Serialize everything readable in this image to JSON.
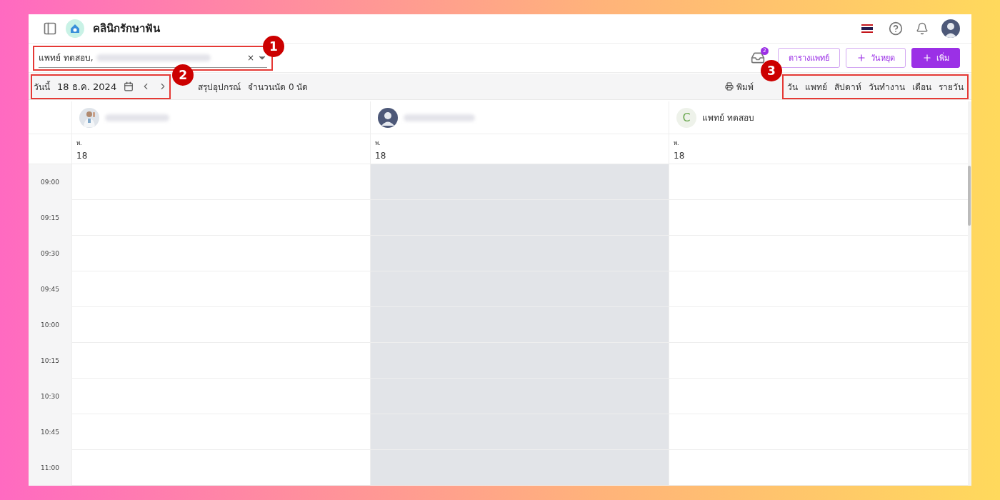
{
  "header": {
    "clinic_name": "คลินิกรักษาฟัน"
  },
  "doctor_filter": {
    "value": "แพทย์ ทดสอบ,",
    "clear": "×"
  },
  "inbox": {
    "count": "2"
  },
  "buttons": [
    {
      "label": "ตารางแพทย์",
      "kind": "outline"
    },
    {
      "label": "วันหยุด",
      "kind": "outline-plus"
    },
    {
      "label": "เพิ่ม",
      "kind": "primary-plus"
    }
  ],
  "date_bar": {
    "today": "วันนี้",
    "date": "18 ธ.ค. 2024",
    "summary": "สรุปอุปกรณ์",
    "count": "จำนวนนัด 0 นัด",
    "print": "พิมพ์"
  },
  "views": [
    "วัน",
    "แพทย์",
    "สัปดาห์",
    "วันทำงาน",
    "เดือน",
    "รายวัน"
  ],
  "columns": [
    {
      "weekday": "พ.",
      "day": "18",
      "unavailable": false
    },
    {
      "kind": "silhouette",
      "weekday": "พ.",
      "day": "18",
      "unavailable": true
    },
    {
      "kind": "letter",
      "initial": "C",
      "name": "แพทย์ ทดสอบ",
      "weekday": "พ.",
      "day": "18",
      "unavailable": false
    }
  ],
  "times": [
    "09:00",
    "09:15",
    "09:30",
    "09:45",
    "10:00",
    "10:15",
    "10:30",
    "10:45",
    "11:00"
  ],
  "annotations": [
    "1",
    "2",
    "3"
  ]
}
